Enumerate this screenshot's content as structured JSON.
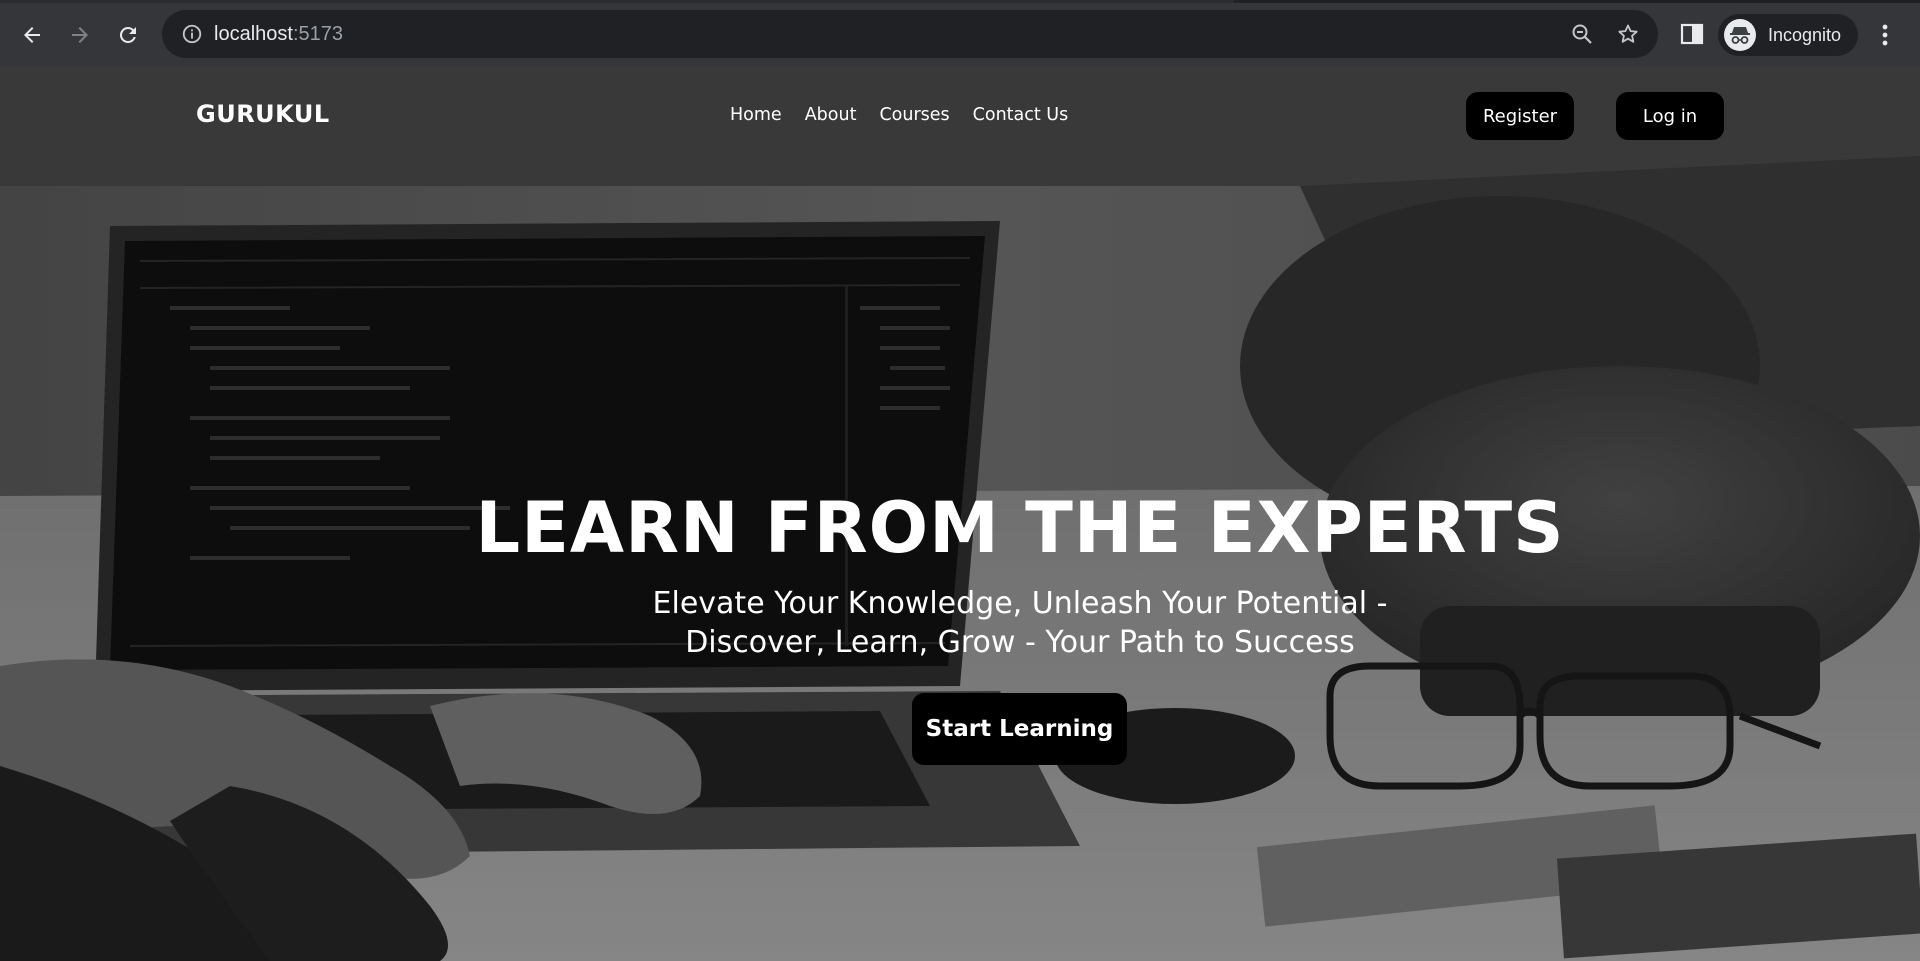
{
  "browser": {
    "url_host": "localhost",
    "url_port": ":5173",
    "profile_label": "Incognito",
    "icons": {
      "back": "arrow-left-icon",
      "forward": "arrow-right-icon",
      "reload": "reload-icon",
      "info": "info-icon",
      "zoom": "zoom-out-icon",
      "bookmark": "star-icon",
      "side_panel": "side-panel-icon",
      "profile": "incognito-icon",
      "menu": "kebab-menu-icon"
    }
  },
  "site": {
    "brand": "GURUKUL",
    "nav": [
      {
        "label": "Home"
      },
      {
        "label": "About"
      },
      {
        "label": "Courses"
      },
      {
        "label": "Contact Us"
      }
    ],
    "register_label": "Register",
    "login_label": "Log in"
  },
  "hero": {
    "title": "LEARN FROM THE EXPERTS",
    "subtitle_line1": "Elevate Your Knowledge, Unleash Your Potential -",
    "subtitle_line2": "Discover, Learn, Grow - Your Path to Success",
    "cta_label": "Start Learning"
  },
  "colors": {
    "chrome_bg": "#35363a",
    "omnibox_bg": "#202124",
    "button_bg": "#000000",
    "text": "#ffffff"
  }
}
